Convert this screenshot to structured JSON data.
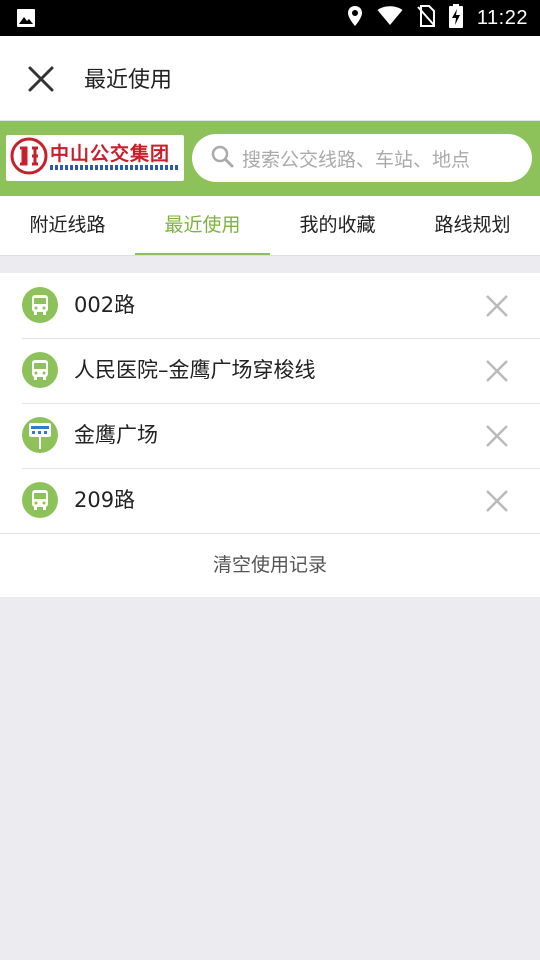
{
  "status_bar": {
    "time": "11:22",
    "icons": [
      "gallery-icon",
      "location-icon",
      "wifi-icon",
      "no-sim-icon",
      "battery-charging-icon"
    ]
  },
  "header": {
    "title": "最近使用",
    "close_icon": "close-icon"
  },
  "logo": {
    "text": "中山公交集团"
  },
  "search": {
    "placeholder": "搜索公交线路、车站、地点"
  },
  "tabs": [
    {
      "label": "附近线路",
      "active": false
    },
    {
      "label": "最近使用",
      "active": true
    },
    {
      "label": "我的收藏",
      "active": false
    },
    {
      "label": "路线规划",
      "active": false
    }
  ],
  "recent_items": [
    {
      "label": "002路",
      "icon": "bus-icon"
    },
    {
      "label": "人民医院–金鹰广场穿梭线",
      "icon": "bus-icon"
    },
    {
      "label": "金鹰广场",
      "icon": "bus-stop-icon"
    },
    {
      "label": "209路",
      "icon": "bus-icon"
    }
  ],
  "clear_label": "清空使用记录",
  "colors": {
    "accent": "#8dc25a",
    "accent_text": "#7cb342",
    "background": "#ebebf0"
  }
}
